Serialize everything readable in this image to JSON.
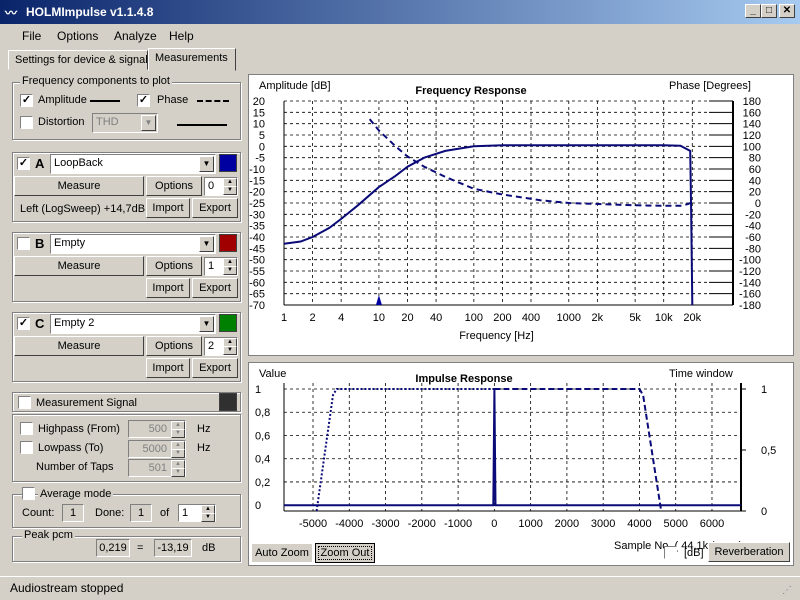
{
  "window": {
    "title": "HOLMImpulse  v1.1.4.8"
  },
  "menu": [
    "File",
    "Options",
    "Analyze",
    "Help"
  ],
  "tabs": [
    "Settings for device & signal",
    "Measurements"
  ],
  "freq_components": {
    "title": "Frequency components to plot",
    "amplitude_label": "Amplitude",
    "amplitude_checked": true,
    "phase_label": "Phase",
    "phase_checked": true,
    "distortion_label": "Distortion",
    "distortion_checked": false,
    "distortion_select": "THD"
  },
  "channels": [
    {
      "letter": "A",
      "checked": true,
      "name": "LoopBack",
      "color": "#0000a0",
      "measure": "Measure",
      "options": "Options",
      "spin": "0",
      "info": "Left (LogSweep) +14,7dB",
      "import": "Import",
      "export": "Export"
    },
    {
      "letter": "B",
      "checked": false,
      "name": "Empty",
      "color": "#a00000",
      "measure": "Measure",
      "options": "Options",
      "spin": "1",
      "info": "",
      "import": "Import",
      "export": "Export"
    },
    {
      "letter": "C",
      "checked": true,
      "name": "Empty 2",
      "color": "#008000",
      "measure": "Measure",
      "options": "Options",
      "spin": "2",
      "info": "",
      "import": "Import",
      "export": "Export"
    }
  ],
  "measurement_signal": {
    "label": "Measurement Signal",
    "checked": false,
    "color": "#303030"
  },
  "filters": {
    "highpass_label": "Highpass (From)",
    "highpass_value": "500",
    "highpass_unit": "Hz",
    "lowpass_label": "Lowpass (To)",
    "lowpass_value": "5000",
    "lowpass_unit": "Hz",
    "taps_label": "Number of Taps",
    "taps_value": "501"
  },
  "average": {
    "label": "Average mode",
    "count_label": "Count:",
    "count": "1",
    "done_label": "Done:",
    "done": "1",
    "of_label": "of",
    "of_value": "1"
  },
  "peak": {
    "label": "Peak pcm",
    "value": "0,219",
    "eq": "=",
    "db_value": "-13,19",
    "unit": "dB"
  },
  "freq_chart": {
    "title": "Frequency Response",
    "left_axis": "Amplitude [dB]",
    "right_axis": "Phase [Degrees]",
    "xlabel": "Frequency [Hz]",
    "left_ticks": [
      "20",
      "15",
      "10",
      "5",
      "0",
      "-5",
      "-10",
      "-15",
      "-20",
      "-25",
      "-30",
      "-35",
      "-40",
      "-45",
      "-50",
      "-55",
      "-60",
      "-65",
      "-70"
    ],
    "right_ticks": [
      "180",
      "160",
      "140",
      "120",
      "100",
      "80",
      "60",
      "40",
      "20",
      "0",
      "-20",
      "-40",
      "-60",
      "-80",
      "-100",
      "-120",
      "-140",
      "-160",
      "-180"
    ],
    "x_ticks": [
      "1",
      "2",
      "4",
      "10",
      "20",
      "40",
      "100",
      "200",
      "400",
      "1000",
      "2k",
      "5k",
      "10k",
      "20k"
    ]
  },
  "imp_chart": {
    "title": "Impulse Response",
    "left_axis": "Value",
    "right_axis": "Time window",
    "xlabel": "Sample No. ( 44,1k / ...... )",
    "left_ticks": [
      "1",
      "0,8",
      "0,6",
      "0,4",
      "0,2",
      "0"
    ],
    "right_ticks": [
      "1",
      "0,5",
      "0"
    ],
    "x_ticks": [
      "-5000",
      "-4000",
      "-3000",
      "-2000",
      "-1000",
      "0",
      "1000",
      "2000",
      "3000",
      "4000",
      "5000",
      "6000"
    ]
  },
  "chart_data": [
    {
      "type": "line",
      "title": "Frequency Response",
      "xlabel": "Frequency [Hz]",
      "ylabel": "Amplitude [dB]",
      "y2label": "Phase [Degrees]",
      "xscale": "log",
      "xlim": [
        1,
        30000
      ],
      "ylim": [
        -70,
        20
      ],
      "y2lim": [
        -180,
        180
      ],
      "grid": true,
      "series": [
        {
          "axis": "left",
          "style": "solid",
          "x": [
            1,
            1.5,
            2,
            3,
            4,
            6,
            10,
            15,
            20,
            30,
            50,
            100,
            200,
            1000,
            5000,
            10000,
            15000,
            19000,
            19500,
            20000
          ],
          "y": [
            -43,
            -42,
            -40,
            -36,
            -32,
            -26,
            -18,
            -13,
            -9,
            -5,
            -2,
            0,
            0.5,
            0.5,
            0.5,
            0.5,
            0.3,
            -2,
            -30,
            -70
          ]
        },
        {
          "axis": "right",
          "style": "dashed",
          "x": [
            8,
            10,
            15,
            20,
            30,
            50,
            100,
            200,
            500,
            1000,
            5000,
            10000,
            15000,
            18000,
            19000
          ],
          "y": [
            148,
            128,
            100,
            82,
            64,
            46,
            25,
            15,
            5,
            0,
            -4,
            -5,
            -5,
            -2,
            0
          ]
        }
      ]
    },
    {
      "type": "line",
      "title": "Impulse Response",
      "xlabel": "Sample No.",
      "ylabel": "Value",
      "y2label": "Time window",
      "xlim": [
        -5800,
        6800
      ],
      "ylim": [
        -0.05,
        1
      ],
      "y2lim": [
        0,
        1
      ],
      "grid": true,
      "series": [
        {
          "axis": "left",
          "style": "solid",
          "x": [
            -5800,
            -30,
            0,
            30,
            6800
          ],
          "y": [
            0,
            0,
            1,
            0,
            0
          ]
        },
        {
          "axis": "right",
          "style": "dotted",
          "x": [
            -4900,
            -4450,
            -4350,
            0
          ],
          "y": [
            0,
            0.95,
            1,
            1
          ]
        },
        {
          "axis": "right",
          "style": "dashed",
          "x": [
            0,
            4000,
            4100,
            4600
          ],
          "y": [
            1,
            1,
            0.95,
            0
          ]
        }
      ]
    }
  ],
  "imp_controls": {
    "auto_zoom": "Auto Zoom",
    "zoom_out": "Zoom Out",
    "db_label": "[dB]",
    "reverberation": "Reverberation"
  },
  "status": "Audiostream stopped"
}
